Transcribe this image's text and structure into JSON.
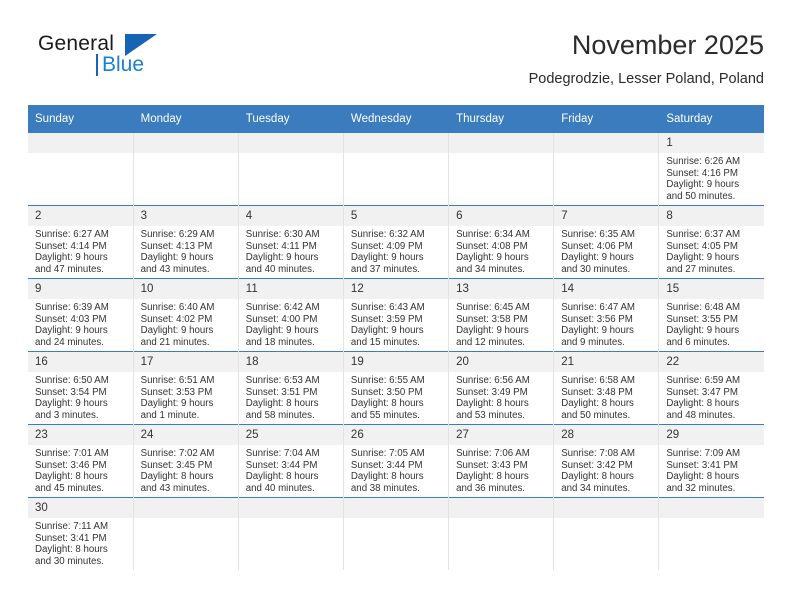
{
  "brand": {
    "name_top": "General",
    "name_bottom": "Blue",
    "accent_color": "#1565b4",
    "accent_color_light": "#1a7fd4"
  },
  "header": {
    "title": "November 2025",
    "location": "Podegrodzie, Lesser Poland, Poland"
  },
  "theme": {
    "header_bar": "#3a7cbe",
    "daynum_bg": "#f1f1f1",
    "row_rule": "#3a7cbe",
    "col_rule": "#e3e3e3",
    "text": "#333333"
  },
  "calendar": {
    "weekday_headers": [
      "Sunday",
      "Monday",
      "Tuesday",
      "Wednesday",
      "Thursday",
      "Friday",
      "Saturday"
    ],
    "labels": {
      "sunrise_prefix": "Sunrise:",
      "sunset_prefix": "Sunset:",
      "daylight_prefix": "Daylight:"
    },
    "weeks": [
      [
        {
          "blank": true
        },
        {
          "blank": true
        },
        {
          "blank": true
        },
        {
          "blank": true
        },
        {
          "blank": true
        },
        {
          "blank": true
        },
        {
          "day": "1",
          "sunrise": "Sunrise: 6:26 AM",
          "sunset": "Sunset: 4:16 PM",
          "daylight_1": "Daylight: 9 hours",
          "daylight_2": "and 50 minutes."
        }
      ],
      [
        {
          "day": "2",
          "sunrise": "Sunrise: 6:27 AM",
          "sunset": "Sunset: 4:14 PM",
          "daylight_1": "Daylight: 9 hours",
          "daylight_2": "and 47 minutes."
        },
        {
          "day": "3",
          "sunrise": "Sunrise: 6:29 AM",
          "sunset": "Sunset: 4:13 PM",
          "daylight_1": "Daylight: 9 hours",
          "daylight_2": "and 43 minutes."
        },
        {
          "day": "4",
          "sunrise": "Sunrise: 6:30 AM",
          "sunset": "Sunset: 4:11 PM",
          "daylight_1": "Daylight: 9 hours",
          "daylight_2": "and 40 minutes."
        },
        {
          "day": "5",
          "sunrise": "Sunrise: 6:32 AM",
          "sunset": "Sunset: 4:09 PM",
          "daylight_1": "Daylight: 9 hours",
          "daylight_2": "and 37 minutes."
        },
        {
          "day": "6",
          "sunrise": "Sunrise: 6:34 AM",
          "sunset": "Sunset: 4:08 PM",
          "daylight_1": "Daylight: 9 hours",
          "daylight_2": "and 34 minutes."
        },
        {
          "day": "7",
          "sunrise": "Sunrise: 6:35 AM",
          "sunset": "Sunset: 4:06 PM",
          "daylight_1": "Daylight: 9 hours",
          "daylight_2": "and 30 minutes."
        },
        {
          "day": "8",
          "sunrise": "Sunrise: 6:37 AM",
          "sunset": "Sunset: 4:05 PM",
          "daylight_1": "Daylight: 9 hours",
          "daylight_2": "and 27 minutes."
        }
      ],
      [
        {
          "day": "9",
          "sunrise": "Sunrise: 6:39 AM",
          "sunset": "Sunset: 4:03 PM",
          "daylight_1": "Daylight: 9 hours",
          "daylight_2": "and 24 minutes."
        },
        {
          "day": "10",
          "sunrise": "Sunrise: 6:40 AM",
          "sunset": "Sunset: 4:02 PM",
          "daylight_1": "Daylight: 9 hours",
          "daylight_2": "and 21 minutes."
        },
        {
          "day": "11",
          "sunrise": "Sunrise: 6:42 AM",
          "sunset": "Sunset: 4:00 PM",
          "daylight_1": "Daylight: 9 hours",
          "daylight_2": "and 18 minutes."
        },
        {
          "day": "12",
          "sunrise": "Sunrise: 6:43 AM",
          "sunset": "Sunset: 3:59 PM",
          "daylight_1": "Daylight: 9 hours",
          "daylight_2": "and 15 minutes."
        },
        {
          "day": "13",
          "sunrise": "Sunrise: 6:45 AM",
          "sunset": "Sunset: 3:58 PM",
          "daylight_1": "Daylight: 9 hours",
          "daylight_2": "and 12 minutes."
        },
        {
          "day": "14",
          "sunrise": "Sunrise: 6:47 AM",
          "sunset": "Sunset: 3:56 PM",
          "daylight_1": "Daylight: 9 hours",
          "daylight_2": "and 9 minutes."
        },
        {
          "day": "15",
          "sunrise": "Sunrise: 6:48 AM",
          "sunset": "Sunset: 3:55 PM",
          "daylight_1": "Daylight: 9 hours",
          "daylight_2": "and 6 minutes."
        }
      ],
      [
        {
          "day": "16",
          "sunrise": "Sunrise: 6:50 AM",
          "sunset": "Sunset: 3:54 PM",
          "daylight_1": "Daylight: 9 hours",
          "daylight_2": "and 3 minutes."
        },
        {
          "day": "17",
          "sunrise": "Sunrise: 6:51 AM",
          "sunset": "Sunset: 3:53 PM",
          "daylight_1": "Daylight: 9 hours",
          "daylight_2": "and 1 minute."
        },
        {
          "day": "18",
          "sunrise": "Sunrise: 6:53 AM",
          "sunset": "Sunset: 3:51 PM",
          "daylight_1": "Daylight: 8 hours",
          "daylight_2": "and 58 minutes."
        },
        {
          "day": "19",
          "sunrise": "Sunrise: 6:55 AM",
          "sunset": "Sunset: 3:50 PM",
          "daylight_1": "Daylight: 8 hours",
          "daylight_2": "and 55 minutes."
        },
        {
          "day": "20",
          "sunrise": "Sunrise: 6:56 AM",
          "sunset": "Sunset: 3:49 PM",
          "daylight_1": "Daylight: 8 hours",
          "daylight_2": "and 53 minutes."
        },
        {
          "day": "21",
          "sunrise": "Sunrise: 6:58 AM",
          "sunset": "Sunset: 3:48 PM",
          "daylight_1": "Daylight: 8 hours",
          "daylight_2": "and 50 minutes."
        },
        {
          "day": "22",
          "sunrise": "Sunrise: 6:59 AM",
          "sunset": "Sunset: 3:47 PM",
          "daylight_1": "Daylight: 8 hours",
          "daylight_2": "and 48 minutes."
        }
      ],
      [
        {
          "day": "23",
          "sunrise": "Sunrise: 7:01 AM",
          "sunset": "Sunset: 3:46 PM",
          "daylight_1": "Daylight: 8 hours",
          "daylight_2": "and 45 minutes."
        },
        {
          "day": "24",
          "sunrise": "Sunrise: 7:02 AM",
          "sunset": "Sunset: 3:45 PM",
          "daylight_1": "Daylight: 8 hours",
          "daylight_2": "and 43 minutes."
        },
        {
          "day": "25",
          "sunrise": "Sunrise: 7:04 AM",
          "sunset": "Sunset: 3:44 PM",
          "daylight_1": "Daylight: 8 hours",
          "daylight_2": "and 40 minutes."
        },
        {
          "day": "26",
          "sunrise": "Sunrise: 7:05 AM",
          "sunset": "Sunset: 3:44 PM",
          "daylight_1": "Daylight: 8 hours",
          "daylight_2": "and 38 minutes."
        },
        {
          "day": "27",
          "sunrise": "Sunrise: 7:06 AM",
          "sunset": "Sunset: 3:43 PM",
          "daylight_1": "Daylight: 8 hours",
          "daylight_2": "and 36 minutes."
        },
        {
          "day": "28",
          "sunrise": "Sunrise: 7:08 AM",
          "sunset": "Sunset: 3:42 PM",
          "daylight_1": "Daylight: 8 hours",
          "daylight_2": "and 34 minutes."
        },
        {
          "day": "29",
          "sunrise": "Sunrise: 7:09 AM",
          "sunset": "Sunset: 3:41 PM",
          "daylight_1": "Daylight: 8 hours",
          "daylight_2": "and 32 minutes."
        }
      ],
      [
        {
          "day": "30",
          "sunrise": "Sunrise: 7:11 AM",
          "sunset": "Sunset: 3:41 PM",
          "daylight_1": "Daylight: 8 hours",
          "daylight_2": "and 30 minutes."
        },
        {
          "blank": true
        },
        {
          "blank": true
        },
        {
          "blank": true
        },
        {
          "blank": true
        },
        {
          "blank": true
        },
        {
          "blank": true
        }
      ]
    ]
  }
}
